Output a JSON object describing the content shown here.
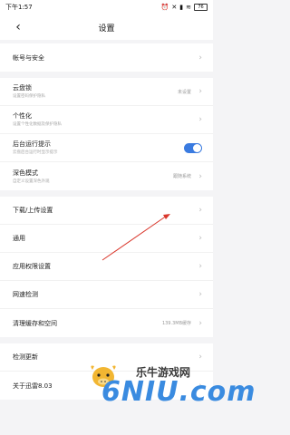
{
  "status_bar": {
    "time": "下午1:57",
    "battery": "76"
  },
  "header": {
    "title": "设置"
  },
  "groups": [
    {
      "rows": [
        {
          "label": "帐号与安全"
        }
      ]
    },
    {
      "rows": [
        {
          "label": "云盘锁",
          "sub": "设置密码保护隐私",
          "value": "未设置"
        },
        {
          "label": "个性化",
          "sub": "设置个性化数据及保护隐私"
        },
        {
          "label": "后台运行提示",
          "sub": "云盘后台运行时显示提示",
          "toggle": true
        },
        {
          "label": "深色模式",
          "sub": "自定义设置深色外观",
          "value": "跟随系统"
        }
      ]
    },
    {
      "rows": [
        {
          "label": "下载/上传设置"
        },
        {
          "label": "通用"
        },
        {
          "label": "应用权限设置"
        },
        {
          "label": "网速检测"
        },
        {
          "label": "清理缓存和空间",
          "value": "139.3MB缓存"
        }
      ]
    },
    {
      "rows": [
        {
          "label": "检测更新"
        },
        {
          "label": "关于迅雷8.03"
        }
      ]
    }
  ],
  "watermark": {
    "top": "乐牛游戏网",
    "bottom": "6NIU.com"
  },
  "colors": {
    "accent": "#3a7be0",
    "annotation_arrow": "#d9362b",
    "background": "#f4f4f6"
  }
}
